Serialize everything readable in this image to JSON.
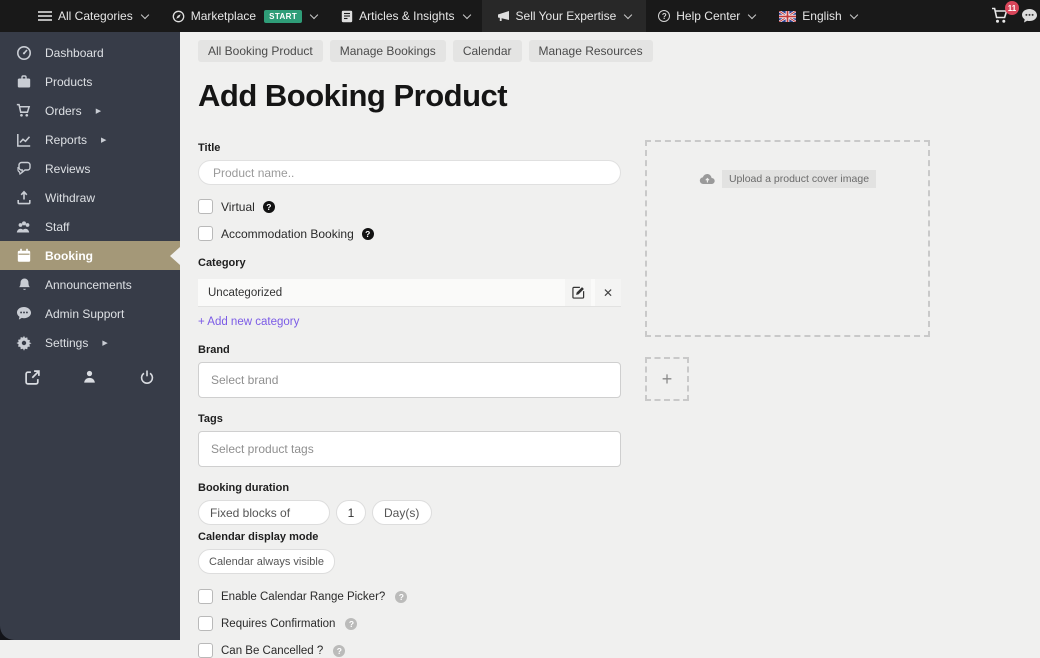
{
  "navbar": {
    "items": [
      {
        "label": "All Categories",
        "icon": "menu-icon"
      },
      {
        "label": "Marketplace",
        "icon": "compass-icon",
        "badge": "START"
      },
      {
        "label": "Articles & Insights",
        "icon": "book-icon"
      },
      {
        "label": "Sell Your Expertise",
        "icon": "megaphone-icon"
      },
      {
        "label": "Help Center",
        "icon": "help-icon"
      },
      {
        "label": "English",
        "icon": "uk-flag-icon"
      }
    ],
    "cart_count": "11"
  },
  "sidebar": {
    "items": [
      {
        "label": "Dashboard",
        "icon": "gauge-icon"
      },
      {
        "label": "Products",
        "icon": "briefcase-icon"
      },
      {
        "label": "Orders",
        "icon": "cart-icon",
        "submenu": true
      },
      {
        "label": "Reports",
        "icon": "chart-icon",
        "submenu": true
      },
      {
        "label": "Reviews",
        "icon": "reviews-icon"
      },
      {
        "label": "Withdraw",
        "icon": "withdraw-icon"
      },
      {
        "label": "Staff",
        "icon": "staff-icon"
      },
      {
        "label": "Booking",
        "icon": "calendar-icon",
        "active": true
      },
      {
        "label": "Announcements",
        "icon": "bell-icon"
      },
      {
        "label": "Admin Support",
        "icon": "support-icon"
      },
      {
        "label": "Settings",
        "icon": "gear-icon",
        "submenu": true
      }
    ]
  },
  "tabs": [
    {
      "label": "All Booking Product"
    },
    {
      "label": "Manage Bookings"
    },
    {
      "label": "Calendar"
    },
    {
      "label": "Manage Resources"
    }
  ],
  "page": {
    "title": "Add Booking Product"
  },
  "form": {
    "title": {
      "label": "Title",
      "placeholder": "Product name.."
    },
    "virtual": {
      "label": "Virtual"
    },
    "accommodation": {
      "label": "Accommodation Booking"
    },
    "category": {
      "label": "Category",
      "value": "Uncategorized",
      "add_link": "+ Add new category"
    },
    "brand": {
      "label": "Brand",
      "placeholder": "Select brand"
    },
    "tags": {
      "label": "Tags",
      "placeholder": "Select product tags"
    },
    "duration": {
      "label": "Booking duration",
      "type_value": "Fixed blocks of",
      "count_value": "1",
      "unit_value": "Day(s)"
    },
    "calendar_mode": {
      "label": "Calendar display mode",
      "value": "Calendar always visible"
    },
    "options": [
      {
        "label": "Enable Calendar Range Picker?"
      },
      {
        "label": "Requires Confirmation"
      },
      {
        "label": "Can Be Cancelled ?"
      }
    ]
  },
  "upload": {
    "cover_label": "Upload a product cover image",
    "add_more_glyph": "+"
  },
  "icons": {
    "question": "?",
    "close": "✕",
    "submenu_arrow": "▶"
  },
  "colors": {
    "navbar_bg": "#191919",
    "sidebar_bg": "#373c48",
    "active_item": "#a49878",
    "content_bg": "#f0f0ef",
    "start_badge": "#2f9d78",
    "cart_badge": "#d9465a",
    "link_purple": "#7b5be6"
  }
}
